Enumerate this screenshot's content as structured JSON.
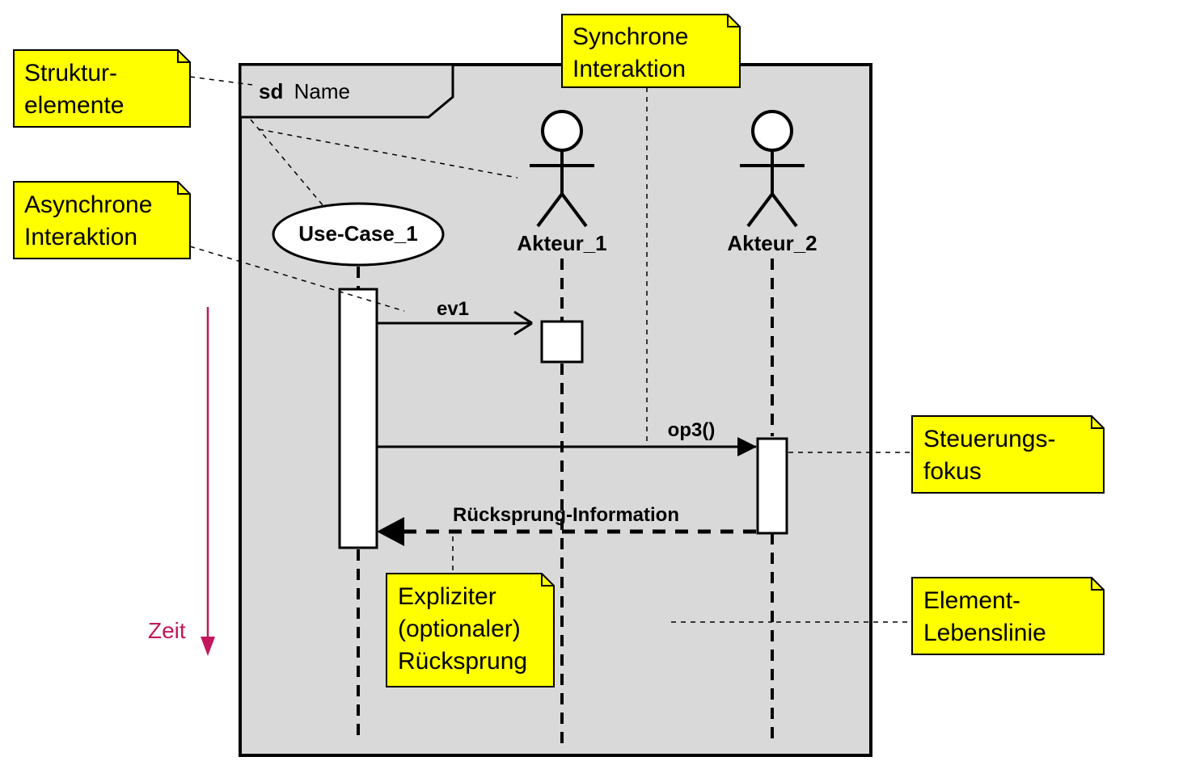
{
  "frame": {
    "sd_prefix": "sd",
    "name_label": "Name"
  },
  "participants": {
    "usecase": "Use-Case_1",
    "actor1": "Akteur_1",
    "actor2": "Akteur_2"
  },
  "messages": {
    "ev1": "ev1",
    "op3": "op3()",
    "return_info": "Rücksprung-Information"
  },
  "annotations": {
    "structural_elements_l1": "Struktur-",
    "structural_elements_l2": "elemente",
    "sync_interaction_l1": "Synchrone",
    "sync_interaction_l2": "Interaktion",
    "async_interaction_l1": "Asynchrone",
    "async_interaction_l2": "Interaktion",
    "control_focus_l1": "Steuerungs-",
    "control_focus_l2": "fokus",
    "element_lifeline_l1": "Element-",
    "element_lifeline_l2": "Lebenslinie",
    "explicit_return_l1": "Expliziter",
    "explicit_return_l2": "(optionaler)",
    "explicit_return_l3": "Rücksprung",
    "time": "Zeit"
  }
}
